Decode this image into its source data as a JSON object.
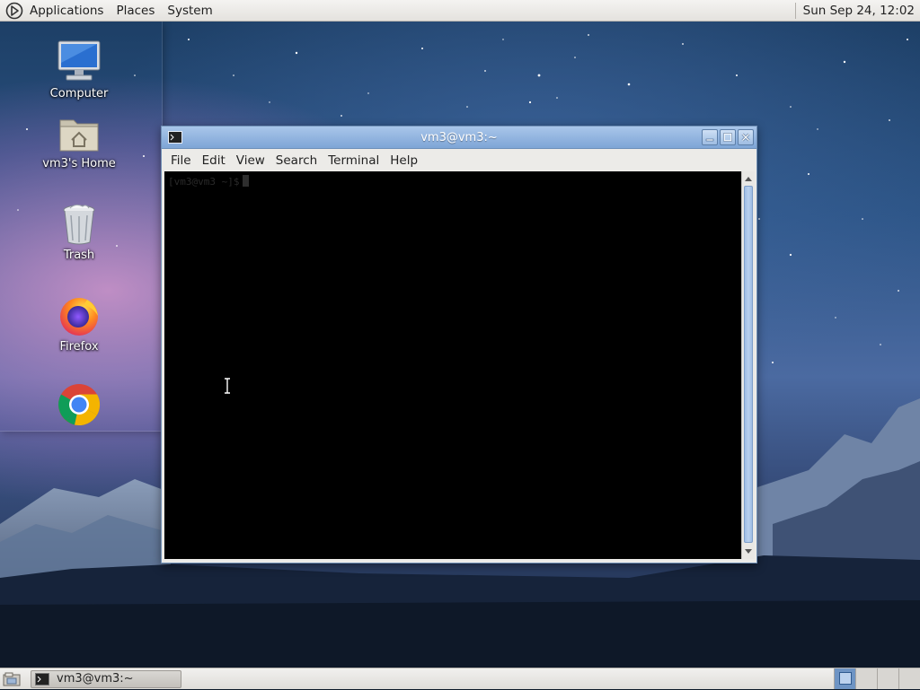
{
  "top_panel": {
    "menus": [
      "Applications",
      "Places",
      "System"
    ],
    "clock": "Sun Sep 24, 12:02"
  },
  "desktop": {
    "icons": [
      {
        "label": "Computer",
        "icon": "computer-icon"
      },
      {
        "label": "vm3's Home",
        "icon": "home-folder-icon"
      },
      {
        "label": "Trash",
        "icon": "trash-icon"
      },
      {
        "label": "Firefox",
        "icon": "firefox-icon"
      },
      {
        "label": "",
        "icon": "chrome-icon"
      }
    ]
  },
  "terminal_window": {
    "title": "vm3@vm3:~",
    "menus": [
      "File",
      "Edit",
      "View",
      "Search",
      "Terminal",
      "Help"
    ],
    "prompt": "[vm3@vm3 ~]$"
  },
  "taskbar": {
    "tasks": [
      {
        "label": "vm3@vm3:~",
        "icon": "terminal-icon"
      }
    ],
    "workspaces": 4,
    "active_workspace": 1
  },
  "colors": {
    "titlebar": "#8fb3e0",
    "terminal_bg": "#000000",
    "panel_bg": "#e9e7e4",
    "active_workspace": "#6e94c4"
  }
}
